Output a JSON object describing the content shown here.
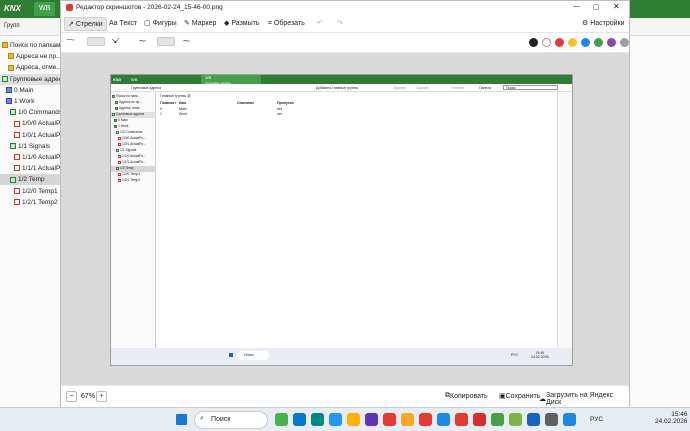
{
  "bg_app": {
    "logo": "KNX",
    "tab": "WB",
    "toolbar_label": "Групп",
    "sidebar": [
      {
        "label": "Поиск по папкам",
        "icon": "folder"
      },
      {
        "label": "Адреса не пр...",
        "icon": "folder-badge"
      },
      {
        "label": "Адреса, отме...",
        "icon": "folder-badge"
      },
      {
        "label": "Групповые адреса",
        "icon": "ga"
      },
      {
        "label": "0 Main",
        "icon": "group-blue"
      },
      {
        "label": "1 Work",
        "icon": "group-blue"
      },
      {
        "label": "1/0 Commands",
        "icon": "group"
      },
      {
        "label": "1/0/0 ActualPo...",
        "icon": "address"
      },
      {
        "label": "1/0/1 ActualPo...",
        "icon": "address"
      },
      {
        "label": "1/1 Signals",
        "icon": "group"
      },
      {
        "label": "1/1/0 ActualPo...",
        "icon": "address"
      },
      {
        "label": "1/1/1 ActualPo...",
        "icon": "address"
      },
      {
        "label": "1/2 Temp",
        "icon": "group"
      },
      {
        "label": "1/2/0 Temp1",
        "icon": "address"
      },
      {
        "label": "1/2/1 Temp2",
        "icon": "address"
      }
    ]
  },
  "editor": {
    "title": "Редактор скриншотов - 2026-02-24_15-46-00.png",
    "tools": [
      "Стрелки",
      "Текст",
      "Фигуры",
      "Маркер",
      "Размыть",
      "Обрезать"
    ],
    "settings": "Настройки",
    "colors": [
      "#222222",
      "#ffffff",
      "#e53935",
      "#fbc02d",
      "#1e88e5",
      "#43a047",
      "#8e44ad",
      "#9e9e9e"
    ],
    "zoom": "67%",
    "zoom_minus": "−",
    "zoom_plus": "+",
    "copy": "Копировать",
    "save": "Сохранить",
    "upload": "Загрузить на Яндекс Диск"
  },
  "inner": {
    "tab": "WB",
    "tab2": "WB",
    "tab2_sub": "Групповые адреса",
    "breadcrumb": "Групповые адреса",
    "toolbar": [
      "Добавить главные группы",
      "Удалить",
      "Скачать",
      "Отмена",
      "Панели"
    ],
    "search_ph": "Поиск",
    "main_header": "Главные группы",
    "main_count": "2",
    "columns": [
      "Главная г",
      "Имя",
      "Описание",
      "Пропуски"
    ],
    "rows": [
      {
        "num": "0",
        "name": "Main",
        "skip": "нет"
      },
      {
        "num": "1",
        "name": "Work",
        "skip": "нет"
      }
    ],
    "side": [
      "Поиск по папк...",
      "Адреса не пр...",
      "Адреса, отме...",
      "Групповые адреса",
      "0 Main",
      "1 Work",
      "1/0 Commands",
      "1/0/0 ActualPo...",
      "1/0/1 ActualPo...",
      "1/1 Signals",
      "1/1/0 ActualPo...",
      "1/1/1 ActualPo...",
      "1/2 Temp",
      "1/2/0 Temp1",
      "1/2/1 Temp2"
    ],
    "task_search": "Поиск",
    "clock": "15:45",
    "date": "24.02.2026",
    "lang": "РУС"
  },
  "taskbar": {
    "search": "Поиск",
    "lang": "РУС",
    "time": "15:46",
    "date": "24.02.2026"
  }
}
